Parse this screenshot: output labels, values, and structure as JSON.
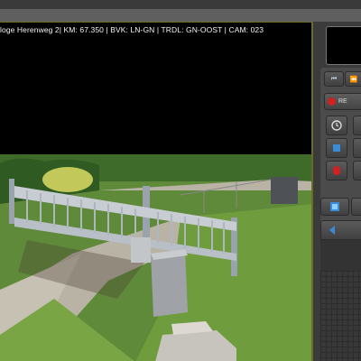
{
  "camera_overlay": {
    "info_text": "loge Herenweg 2| KM: 67.350 | BVK: LN-GN | TRDL: GN-OOST | CAM: 023"
  },
  "controls": {
    "first_label": "⏮",
    "rewind_label": "⏪",
    "record_label": "RE",
    "clock_icon": "clock-icon",
    "stop_icon": "stop-icon",
    "record_icon": "record-icon",
    "fullscreen_icon": "fullscreen-icon",
    "back_icon": "back-arrow-icon"
  },
  "colors": {
    "frame_border": "#6b6b22",
    "accent_blue": "#3a8bd8",
    "record_red": "#d02020"
  }
}
